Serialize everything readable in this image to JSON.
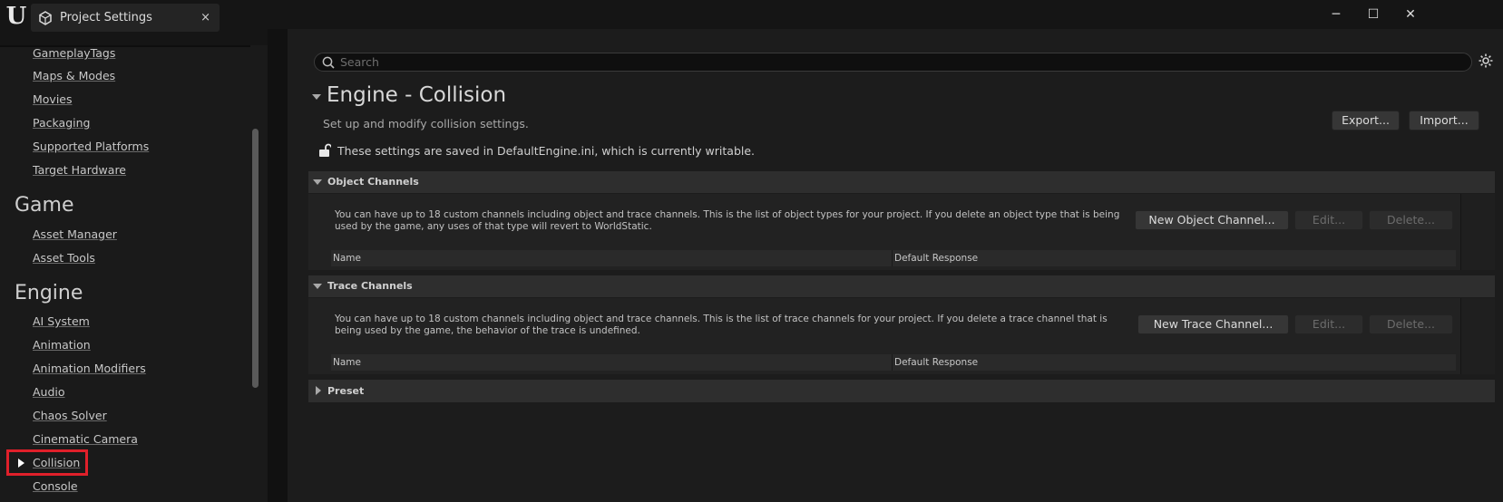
{
  "window": {
    "tab_title": "Project Settings",
    "tab_close": "×",
    "logo": "U",
    "minimize": "─",
    "maximize": "☐",
    "close": "✕"
  },
  "sidebar": {
    "items_top": [
      "GameplayTags",
      "Maps & Modes",
      "Movies",
      "Packaging",
      "Supported Platforms",
      "Target Hardware"
    ],
    "section_game": "Game",
    "items_game": [
      "Asset Manager",
      "Asset Tools"
    ],
    "section_engine": "Engine",
    "items_engine": [
      "AI System",
      "Animation",
      "Animation Modifiers",
      "Audio",
      "Chaos Solver",
      "Cinematic Camera",
      "Collision",
      "Console"
    ],
    "selected": "Collision"
  },
  "search": {
    "placeholder": "Search"
  },
  "header": {
    "title": "Engine - Collision",
    "description": "Set up and modify collision settings.",
    "export_label": "Export...",
    "import_label": "Import...",
    "save_note": "These settings are saved in DefaultEngine.ini, which is currently writable."
  },
  "object_channels": {
    "label": "Object Channels",
    "description": "You can have up to 18 custom channels including object and trace channels. This is the list of object types for your project. If you delete an object type that is being used by the game, any uses of that type will revert to WorldStatic.",
    "new_label": "New Object Channel...",
    "edit_label": "Edit...",
    "delete_label": "Delete...",
    "col_name": "Name",
    "col_response": "Default Response"
  },
  "trace_channels": {
    "label": "Trace Channels",
    "description": "You can have up to 18 custom channels including object and trace channels. This is the list of trace channels for your project. If you delete a trace channel that is being used by the game, the behavior of the trace is undefined.",
    "new_label": "New Trace Channel...",
    "edit_label": "Edit...",
    "delete_label": "Delete...",
    "col_name": "Name",
    "col_response": "Default Response"
  },
  "preset": {
    "label": "Preset"
  },
  "colors": {
    "selection_outline": "#e0202a",
    "panel": "#1c1c1c",
    "category_header": "#2e2e2e"
  }
}
